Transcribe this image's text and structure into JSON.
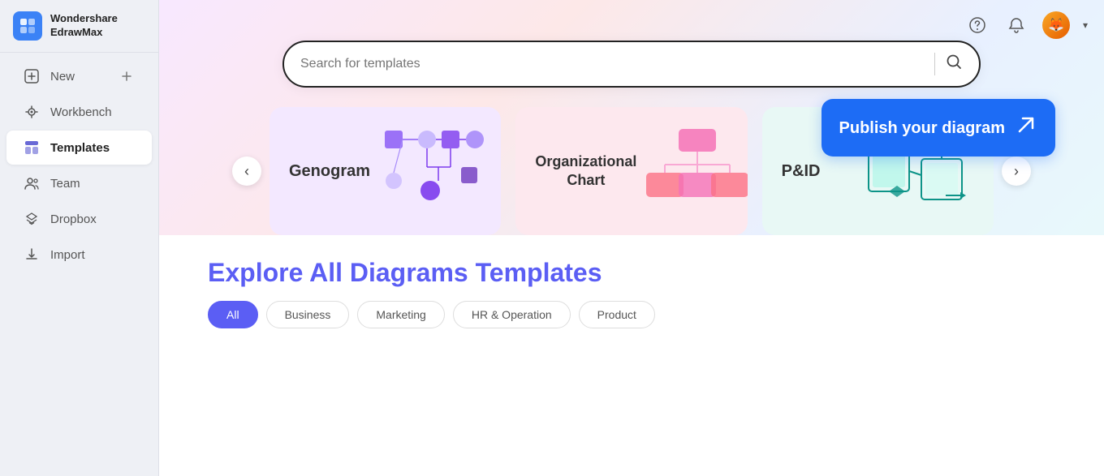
{
  "app": {
    "logo_line1": "Wondershare",
    "logo_line2": "EdrawMax"
  },
  "sidebar": {
    "items": [
      {
        "id": "new",
        "label": "New",
        "icon": "plus-square",
        "active": false,
        "has_add": true
      },
      {
        "id": "workbench",
        "label": "Workbench",
        "icon": "grid",
        "active": false
      },
      {
        "id": "templates",
        "label": "Templates",
        "icon": "template",
        "active": true
      },
      {
        "id": "team",
        "label": "Team",
        "icon": "users",
        "active": false
      },
      {
        "id": "dropbox",
        "label": "Dropbox",
        "icon": "dropbox",
        "active": false
      },
      {
        "id": "import",
        "label": "Import",
        "icon": "import",
        "active": false
      }
    ]
  },
  "search": {
    "placeholder": "Search for templates"
  },
  "carousel": {
    "cards": [
      {
        "id": "genogram",
        "label": "Genogram",
        "bg": "genogram"
      },
      {
        "id": "org-chart",
        "label": "Organizational Chart",
        "bg": "org"
      },
      {
        "id": "pid",
        "label": "P&ID",
        "bg": "pid"
      }
    ]
  },
  "publish": {
    "label": "Publish your diagram",
    "icon": "arrow-right"
  },
  "explore": {
    "title_plain": "Explore ",
    "title_colored": "All Diagrams Templates",
    "filters": [
      {
        "id": "all",
        "label": "All",
        "active": true
      },
      {
        "id": "business",
        "label": "Business",
        "active": false
      },
      {
        "id": "marketing",
        "label": "Marketing",
        "active": false
      },
      {
        "id": "hr-operation",
        "label": "HR & Operation",
        "active": false
      },
      {
        "id": "product",
        "label": "Product",
        "active": false
      }
    ]
  }
}
